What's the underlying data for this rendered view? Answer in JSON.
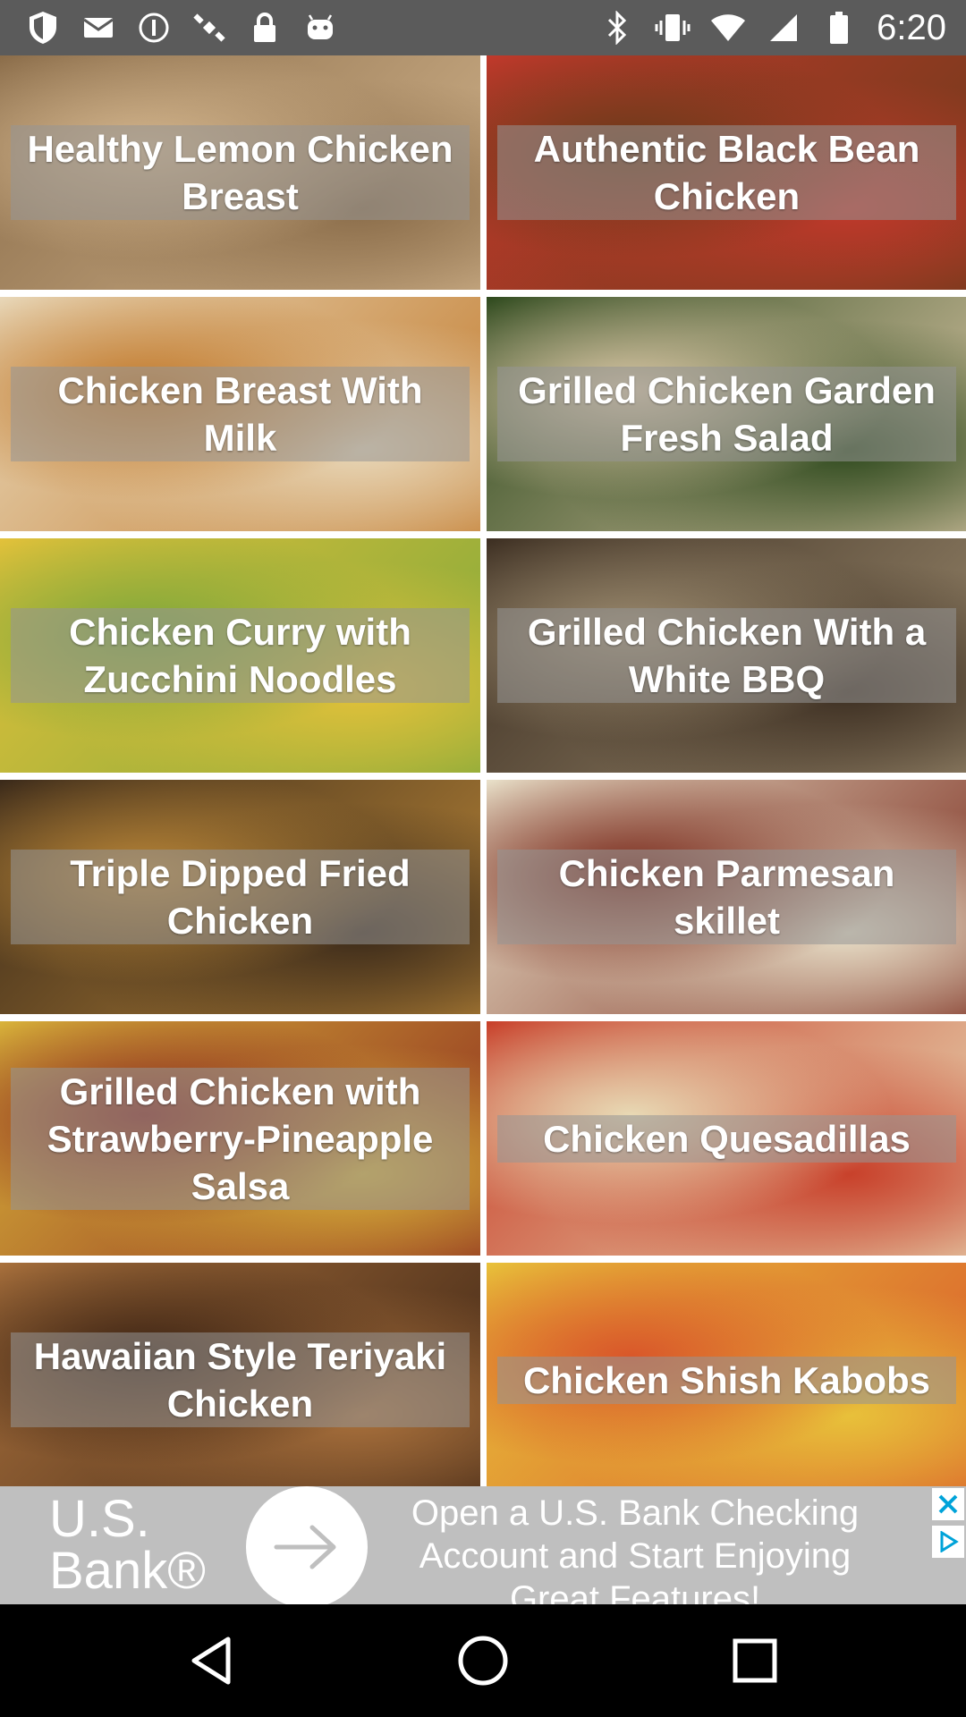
{
  "status_bar": {
    "left_icons": [
      "shield-icon",
      "mail-icon",
      "info-icon",
      "satellite-icon",
      "lock-icon",
      "android-icon"
    ],
    "right_icons": [
      "bluetooth-icon",
      "vibrate-icon",
      "wifi-icon",
      "signal-icon",
      "battery-icon"
    ],
    "time": "6:20"
  },
  "recipes": [
    {
      "title": "Healthy Lemon Chicken Breast",
      "photo_colors": [
        "#d2b48c",
        "#8b6d4a"
      ]
    },
    {
      "title": "Authentic Black Bean Chicken",
      "photo_colors": [
        "#6b3a1a",
        "#c0392b"
      ]
    },
    {
      "title": "Chicken Breast With Milk",
      "photo_colors": [
        "#c27a2c",
        "#e8d7b8"
      ]
    },
    {
      "title": "Grilled Chicken Garden Fresh Salad",
      "photo_colors": [
        "#d9c6a5",
        "#2f4a1e"
      ]
    },
    {
      "title": "Chicken Curry with Zucchini Noodles",
      "photo_colors": [
        "#7fa83a",
        "#e2c13a"
      ]
    },
    {
      "title": "Grilled Chicken With a White BBQ",
      "photo_colors": [
        "#9b8a6e",
        "#3d2f22"
      ]
    },
    {
      "title": "Triple Dipped Fried Chicken",
      "photo_colors": [
        "#b88537",
        "#3b2a1a"
      ]
    },
    {
      "title": "Chicken Parmesan skillet",
      "photo_colors": [
        "#7a2a1c",
        "#e8dfc8"
      ]
    },
    {
      "title": "Grilled Chicken with Strawberry-Pineapple Salsa",
      "photo_colors": [
        "#8c2a1e",
        "#d8b23a"
      ]
    },
    {
      "title": "Chicken Quesadillas",
      "photo_colors": [
        "#e8d9b4",
        "#c8402a"
      ]
    },
    {
      "title": "Hawaiian Style Teriyaki Chicken",
      "photo_colors": [
        "#3d2414",
        "#a8703c"
      ]
    },
    {
      "title": "Chicken Shish Kabobs",
      "photo_colors": [
        "#d9572a",
        "#e8c13a"
      ]
    }
  ],
  "ad": {
    "brand": "U.S. Bank®",
    "text": "Open a U.S. Bank Checking Account and Start Enjoying Great Features!",
    "close_icon": "close-icon",
    "adchoices_icon": "adchoices-icon"
  },
  "nav_bar": {
    "buttons": [
      "back-icon",
      "home-icon",
      "recents-icon"
    ]
  }
}
